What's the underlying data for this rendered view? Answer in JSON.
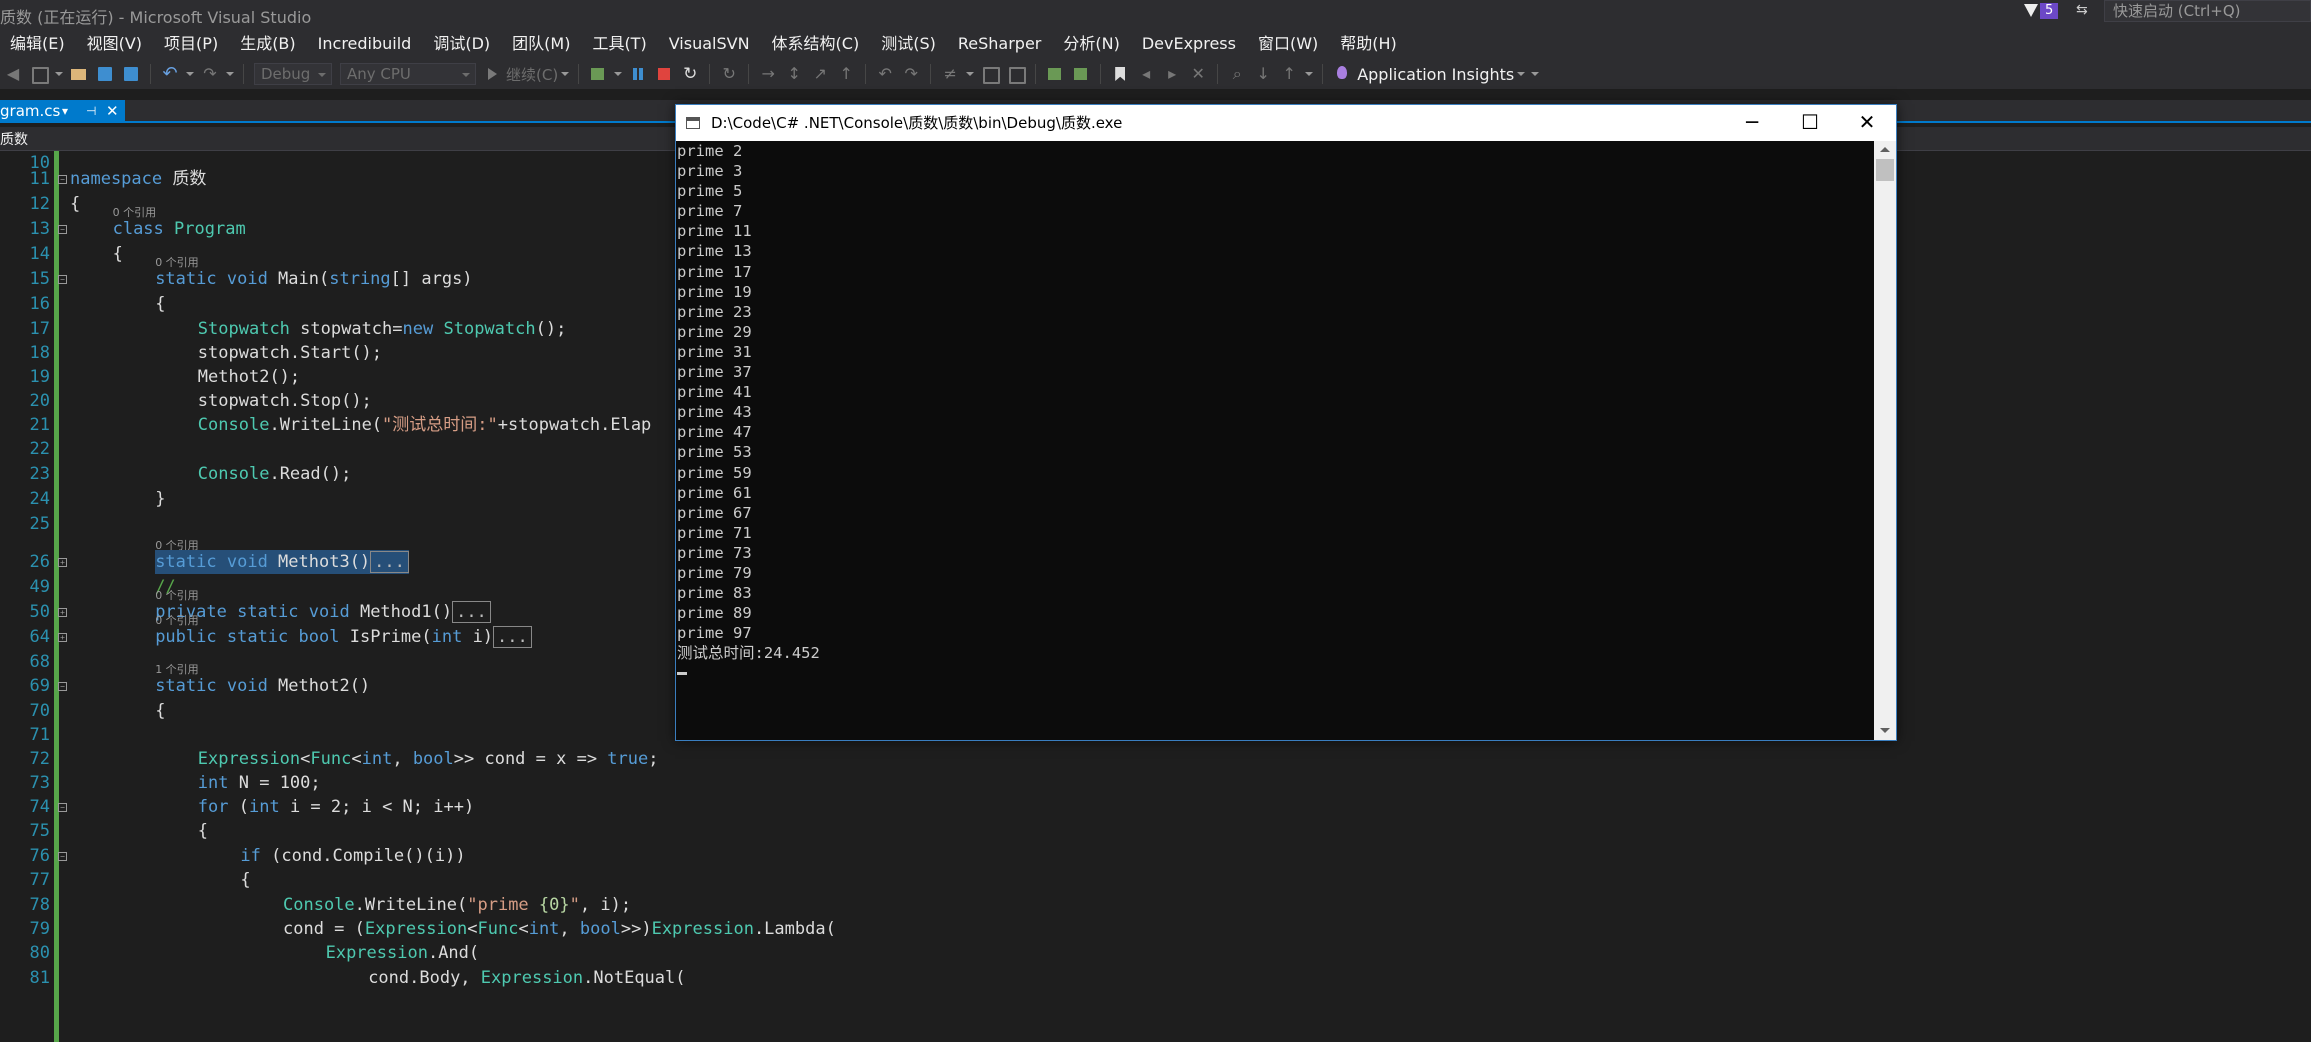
{
  "window_title": "质数 (正在运行) - Microsoft Visual Studio",
  "notifications": {
    "count": "5"
  },
  "quick_launch": {
    "placeholder": "快速启动 (Ctrl+Q)"
  },
  "menu": [
    "编辑(E)",
    "视图(V)",
    "项目(P)",
    "生成(B)",
    "Incredibuild",
    "调试(D)",
    "团队(M)",
    "工具(T)",
    "VisualSVN",
    "体系结构(C)",
    "测试(S)",
    "ReSharper",
    "分析(N)",
    "DevExpress",
    "窗口(W)",
    "帮助(H)"
  ],
  "toolbar": {
    "configuration": "Debug",
    "platform": "Any CPU",
    "continue_label": "继续(C)",
    "app_insights_label": "Application Insights"
  },
  "document_tab": {
    "label": "gram.cs"
  },
  "navbar": {
    "project": "质数"
  },
  "editor": {
    "ref_labels": {
      "r0": "0 个引用",
      "r1": "1 个引用"
    },
    "lines": [
      {
        "n": "10",
        "text": ""
      },
      {
        "n": "11",
        "text": "namespace 质数"
      },
      {
        "n": "12",
        "text": "{"
      },
      {
        "n": "13",
        "text": "class Program"
      },
      {
        "n": "14",
        "text": "{"
      },
      {
        "n": "15",
        "text": "static void Main(string[] args)"
      },
      {
        "n": "16",
        "text": "{"
      },
      {
        "n": "17",
        "text": "Stopwatch stopwatch=new Stopwatch();"
      },
      {
        "n": "18",
        "text": "stopwatch.Start();"
      },
      {
        "n": "19",
        "text": "Methot2();"
      },
      {
        "n": "20",
        "text": "stopwatch.Stop();"
      },
      {
        "n": "21",
        "text": "Console.WriteLine(\"测试总时间:\"+stopwatch.Elap"
      },
      {
        "n": "22",
        "text": ""
      },
      {
        "n": "23",
        "text": "Console.Read();"
      },
      {
        "n": "24",
        "text": "}"
      },
      {
        "n": "25",
        "text": ""
      },
      {
        "n": "26",
        "text": "static void Methot3()"
      },
      {
        "n": "49",
        "text": "//"
      },
      {
        "n": "50",
        "text": "private static void Method1()"
      },
      {
        "n": "64",
        "text": "public static bool IsPrime(int i)"
      },
      {
        "n": "68",
        "text": ""
      },
      {
        "n": "69",
        "text": "static void Methot2()"
      },
      {
        "n": "70",
        "text": "{"
      },
      {
        "n": "71",
        "text": ""
      },
      {
        "n": "72",
        "text": "Expression<Func<int, bool>> cond = x => true;"
      },
      {
        "n": "73",
        "text": "int N = 100;"
      },
      {
        "n": "74",
        "text": "for (int i = 2; i < N; i++)"
      },
      {
        "n": "75",
        "text": "{"
      },
      {
        "n": "76",
        "text": "if (cond.Compile()(i))"
      },
      {
        "n": "77",
        "text": "{"
      },
      {
        "n": "78",
        "text": "Console.WriteLine(\"prime {0}\", i);"
      },
      {
        "n": "79",
        "text": "cond = (Expression<Func<int, bool>>)Expression.Lambda("
      },
      {
        "n": "80",
        "text": "Expression.And("
      },
      {
        "n": "81",
        "text": "cond.Body, Expression.NotEqual("
      }
    ],
    "collapsed_marker": "..."
  },
  "console": {
    "title": "D:\\Code\\C# .NET\\Console\\质数\\质数\\bin\\Debug\\质数.exe",
    "lines": [
      "prime 2",
      "prime 3",
      "prime 5",
      "prime 7",
      "prime 11",
      "prime 13",
      "prime 17",
      "prime 19",
      "prime 23",
      "prime 29",
      "prime 31",
      "prime 37",
      "prime 41",
      "prime 43",
      "prime 47",
      "prime 53",
      "prime 59",
      "prime 61",
      "prime 67",
      "prime 71",
      "prime 73",
      "prime 79",
      "prime 83",
      "prime 89",
      "prime 97",
      "测试总时间:24.452"
    ]
  },
  "colors": {
    "accent": "#007acc",
    "keyword": "#569cd6",
    "type": "#4ec9b0",
    "string": "#d69d85",
    "line_number": "#2b91af",
    "comment": "#57a64a"
  }
}
